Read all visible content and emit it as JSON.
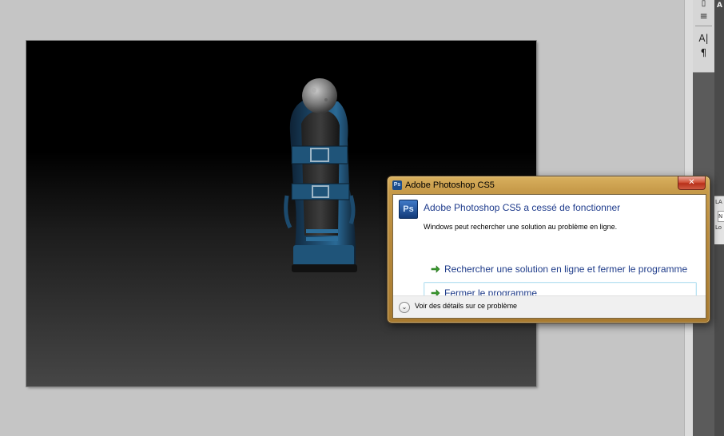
{
  "app": {
    "name": "Adobe Photoshop CS5"
  },
  "dock": {
    "icons": [
      "layer-comps-icon",
      "clone-source-icon",
      "character-icon",
      "paragraph-icon"
    ],
    "glyphs": [
      "▯",
      "≡",
      "A|",
      "¶"
    ],
    "top_fragment": "A",
    "panel_tab_fragment": "LA",
    "panel_field_fragment": "N",
    "panel_hint_fragment": "Lo"
  },
  "dialog": {
    "window_title": "Adobe Photoshop CS5",
    "close_glyph": "✕",
    "app_icon_text": "Ps",
    "main_instruction": "Adobe Photoshop CS5 a cessé de fonctionner",
    "content": "Windows peut rechercher une solution au problème en ligne.",
    "commands": [
      {
        "label": "Rechercher une solution en ligne et fermer le programme"
      },
      {
        "label": "Fermer le programme"
      }
    ],
    "details_label": "Voir des détails sur ce problème",
    "details_glyph": "⌄"
  },
  "colors": {
    "dialog_frame": "#c69a49",
    "link_blue": "#1f3c8a",
    "arrow_green": "#3a9a2e",
    "close_red": "#c7452d",
    "workspace_gray": "#c5c5c5"
  }
}
